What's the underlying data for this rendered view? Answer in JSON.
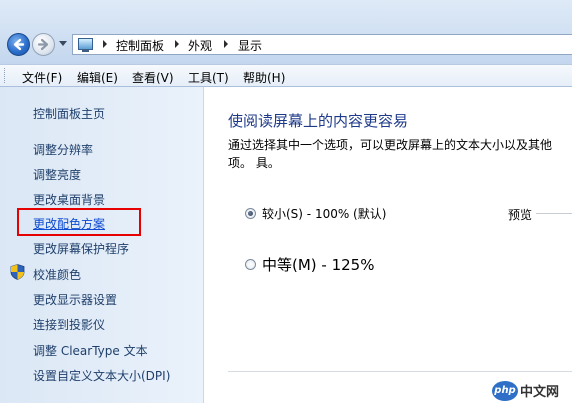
{
  "breadcrumb": {
    "items": [
      "控制面板",
      "外观",
      "显示"
    ]
  },
  "menubar": {
    "items": [
      "文件(F)",
      "编辑(E)",
      "查看(V)",
      "工具(T)",
      "帮助(H)"
    ]
  },
  "sidebar": {
    "home": "控制面板主页",
    "links": [
      "调整分辨率",
      "调整亮度",
      "更改桌面背景",
      "更改配色方案",
      "更改屏幕保护程序",
      "校准颜色",
      "更改显示器设置",
      "连接到投影仪",
      "调整 ClearType 文本",
      "设置自定义文本大小(DPI)"
    ]
  },
  "main": {
    "title": "使阅读屏幕上的内容更容易",
    "description": "通过选择其中一个选项，可以更改屏幕上的文本大小以及其他项。 具。",
    "options": [
      {
        "label": "较小(S) - 100% (默认)",
        "selected": true
      },
      {
        "label": "中等(M) - 125%",
        "selected": false
      }
    ],
    "preview_label": "预览"
  },
  "watermark": {
    "badge": "php",
    "text": "中文网"
  },
  "colors": {
    "title_blue": "#1e3a8a",
    "highlight_red": "#e60000",
    "link": "#1f3f6b"
  }
}
